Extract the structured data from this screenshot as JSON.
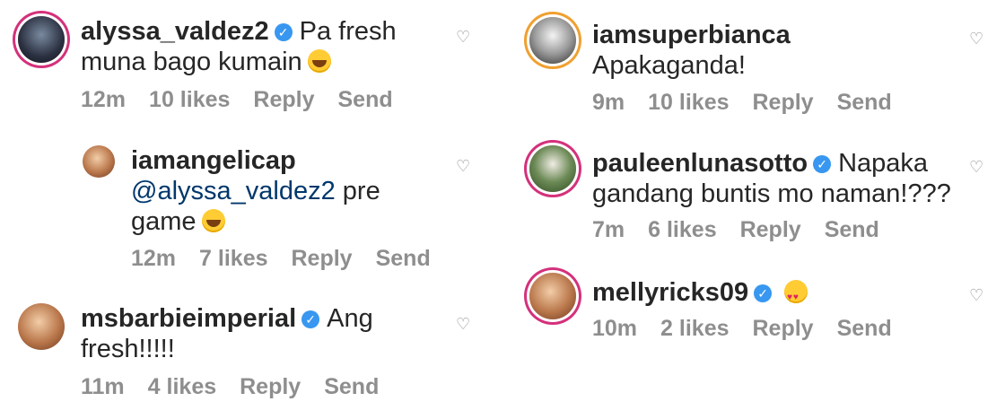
{
  "comments": [
    {
      "username": "alyssa_valdez2",
      "verified": true,
      "text_line1": "Pa fresh",
      "text_line2": "muna bago kumain",
      "emoji": "grin",
      "time": "12m",
      "likes": "10 likes",
      "reply": "Reply",
      "send": "Send",
      "like_icon": "heart-outline-icon"
    },
    {
      "username": "iamangelicap",
      "verified": false,
      "mention": "@alyssa_valdez2",
      "text_after_mention": "pre",
      "text_line3": "game",
      "emoji": "grin",
      "time": "12m",
      "likes": "7 likes",
      "reply": "Reply",
      "send": "Send",
      "like_icon": "heart-outline-icon"
    },
    {
      "username": "msbarbieimperial",
      "verified": true,
      "text_line1": "Ang",
      "text_line2": "fresh!!!!!",
      "time": "11m",
      "likes": "4 likes",
      "reply": "Reply",
      "send": "Send",
      "like_icon": "heart-outline-icon"
    },
    {
      "username": "iamsuperbianca",
      "verified": false,
      "text_line1": "Apakaganda!",
      "time": "9m",
      "likes": "10 likes",
      "reply": "Reply",
      "send": "Send",
      "like_icon": "heart-outline-icon"
    },
    {
      "username": "pauleenlunasotto",
      "verified": true,
      "text_line1": "Napaka",
      "text_line2": "gandang buntis mo naman!???",
      "time": "7m",
      "likes": "6 likes",
      "reply": "Reply",
      "send": "Send",
      "like_icon": "heart-outline-icon"
    },
    {
      "username": "mellyricks09",
      "verified": true,
      "emoji": "heart-eyes",
      "time": "10m",
      "likes": "2 likes",
      "reply": "Reply",
      "send": "Send",
      "like_icon": "heart-outline-icon"
    }
  ],
  "colors": {
    "text": "#262626",
    "meta": "#8e8e8e",
    "verified": "#3897f0",
    "mention": "#00376b",
    "story_ring": "#d4317b"
  }
}
